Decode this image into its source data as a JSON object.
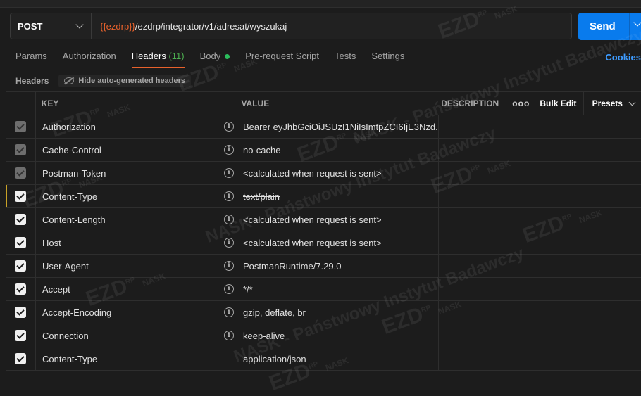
{
  "request": {
    "method": "POST",
    "url_var": "{{ezdrp}}",
    "url_path": "/ezdrp/integrator/v1/adresat/wyszukaj",
    "send_label": "Send"
  },
  "tabs": [
    {
      "label": "Params"
    },
    {
      "label": "Authorization"
    },
    {
      "label": "Headers",
      "count": "(11)",
      "active": true
    },
    {
      "label": "Body"
    },
    {
      "label": "Pre-request Script"
    },
    {
      "label": "Tests"
    },
    {
      "label": "Settings"
    }
  ],
  "cookies_label": "Cookies",
  "headers_section": {
    "title": "Headers",
    "hide_auto_label": "Hide auto-generated headers"
  },
  "table": {
    "col_key": "KEY",
    "col_value": "VALUE",
    "col_description": "DESCRIPTION",
    "more": "ooo",
    "bulk_edit": "Bulk Edit",
    "presets": "Presets",
    "rows": [
      {
        "key": "Authorization",
        "value": "Bearer eyJhbGciOiJSUzI1NiIsImtpZCI6IjE3Nzd...",
        "checked": "dim",
        "info": true
      },
      {
        "key": "Cache-Control",
        "value": "no-cache",
        "checked": "dim",
        "info": true
      },
      {
        "key": "Postman-Token",
        "value": "<calculated when request is sent>",
        "checked": "dim",
        "info": true
      },
      {
        "key": "Content-Type",
        "value": "text/plain",
        "checked": "on",
        "info": true,
        "strike": true
      },
      {
        "key": "Content-Length",
        "value": "<calculated when request is sent>",
        "checked": "on",
        "info": true
      },
      {
        "key": "Host",
        "value": "<calculated when request is sent>",
        "checked": "on",
        "info": true
      },
      {
        "key": "User-Agent",
        "value": "PostmanRuntime/7.29.0",
        "checked": "on",
        "info": true
      },
      {
        "key": "Accept",
        "value": "*/*",
        "checked": "on",
        "info": true
      },
      {
        "key": "Accept-Encoding",
        "value": "gzip, deflate, br",
        "checked": "on",
        "info": true
      },
      {
        "key": "Connection",
        "value": "keep-alive",
        "checked": "on",
        "info": true
      },
      {
        "key": "Content-Type",
        "value": "application/json",
        "checked": "on",
        "info": false
      }
    ]
  },
  "watermark": {
    "logo": "EZD",
    "sup": "RP",
    "brand": "NASK",
    "long": "NASK - Państwowy Instytut Badawczy"
  },
  "colors": {
    "accent": "#e8622c",
    "send": "#097bed",
    "link": "#3d9bff",
    "count": "#4caf50"
  }
}
